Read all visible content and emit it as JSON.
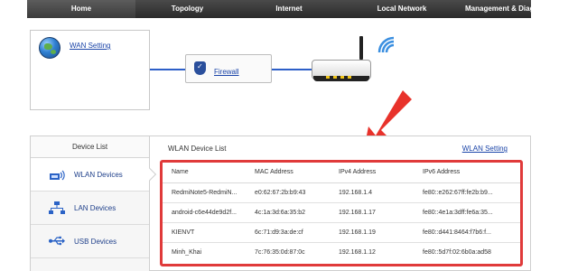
{
  "nav": {
    "items": [
      "Home",
      "Topology",
      "Internet",
      "Local Network",
      "Management & Diagnosis"
    ]
  },
  "topology": {
    "wan_setting_label": "WAN Setting",
    "firewall_label": "Firewall"
  },
  "device_panel": {
    "side_header": "Device List",
    "side_items": [
      "WLAN Devices",
      "LAN Devices",
      "USB Devices"
    ],
    "content_title": "WLAN Device List",
    "content_link": "WLAN Setting",
    "columns": [
      "Name",
      "MAC Address",
      "IPv4 Address",
      "IPv6 Address"
    ],
    "rows": [
      [
        "RedmiNote5-RedmiN...",
        "e0:62:67:2b:b9:43",
        "192.168.1.4",
        "fe80::e262:67ff:fe2b:b9..."
      ],
      [
        "android-c6e44de9d2f...",
        "4c:1a:3d:6a:35:b2",
        "192.168.1.17",
        "fe80::4e1a:3dff:fe6a:35..."
      ],
      [
        "KIENVT",
        "6c:71:d9:3a:de:cf",
        "192.168.1.19",
        "fe80::d441:8464:f7b6:f..."
      ],
      [
        "Minh_Khai",
        "7c:76:35:0d:87:0c",
        "192.168.1.12",
        "fe80::5d7f:02:6b0a:ad58"
      ]
    ]
  },
  "colors": {
    "nav_bg": "#2a2a2a",
    "link": "#1a44a8",
    "connector_line": "#2d5fc8",
    "highlight": "#e03a3a"
  }
}
